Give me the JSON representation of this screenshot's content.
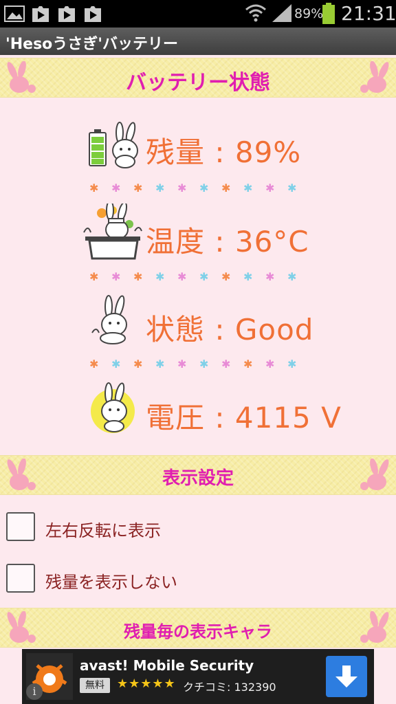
{
  "status_bar": {
    "battery_percent": "89%",
    "time": "21:31"
  },
  "app": {
    "title": "'Hesoうさぎ'バッテリー"
  },
  "battery_section": {
    "header": "バッテリー状態",
    "rows": [
      {
        "label": "残量 : 89%"
      },
      {
        "label": "温度 : 36°C"
      },
      {
        "label": "状態 : Good"
      },
      {
        "label": "電圧 : 4115 V"
      }
    ]
  },
  "display_section": {
    "header": "表示設定",
    "options": [
      {
        "label": "左右反転に表示",
        "checked": false
      },
      {
        "label": "残量を表示しない",
        "checked": false
      }
    ]
  },
  "character_section": {
    "header": "残量毎の表示キャラ"
  },
  "ad": {
    "app_name": "avast! Mobile Security",
    "price_badge": "無料",
    "stars": "★★★★★",
    "rating_fraction": 0.9,
    "review_text": "クチコミ: 132390",
    "info_icon": "i"
  },
  "colors": {
    "accent_magenta": "#e01eb0",
    "value_orange": "#f07036",
    "background_pink": "#fde9ee",
    "banner_yellow": "#f7eda6"
  }
}
